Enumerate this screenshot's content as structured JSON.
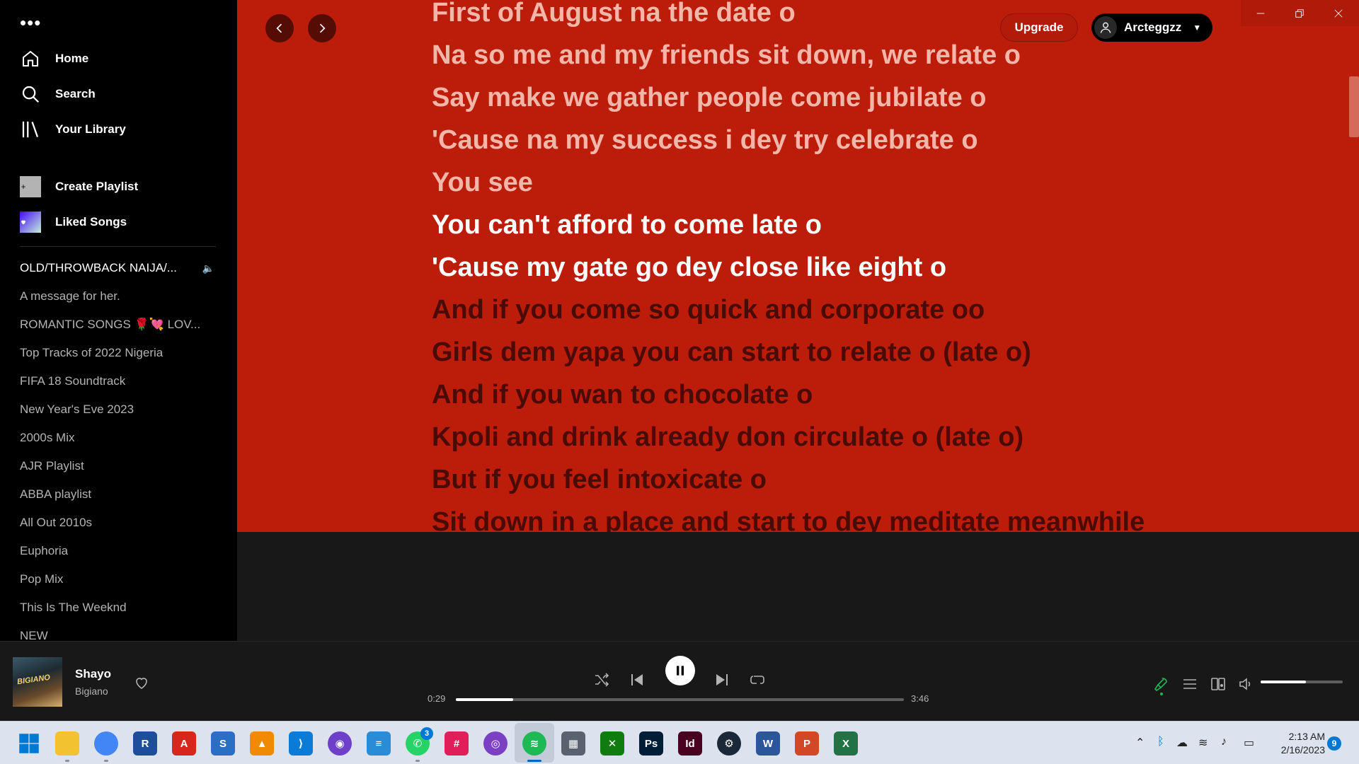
{
  "sidebar": {
    "menu_dots": "•••",
    "nav": [
      {
        "label": "Home",
        "icon": "home-icon"
      },
      {
        "label": "Search",
        "icon": "search-icon"
      },
      {
        "label": "Your Library",
        "icon": "library-icon"
      }
    ],
    "create_playlist": "Create Playlist",
    "liked_songs": "Liked Songs",
    "playlists": [
      "OLD/THROWBACK NAIJA/...",
      "A message for her.",
      "ROMANTIC SONGS 🌹💘 LOV...",
      "Top Tracks of 2022 Nigeria",
      "FIFA 18 Soundtrack",
      "New Year's Eve 2023",
      "2000s Mix",
      "AJR Playlist",
      "ABBA playlist",
      "All Out 2010s",
      "Euphoria",
      "Pop Mix",
      "This Is The Weeknd",
      "NEW"
    ]
  },
  "header": {
    "upgrade": "Upgrade",
    "username": "Arcteggzz"
  },
  "lyrics": [
    {
      "text": "First of August na the date o",
      "state": "past"
    },
    {
      "text": "Na so me and my friends sit down, we relate o",
      "state": "past"
    },
    {
      "text": "Say make we gather people come jubilate o",
      "state": "past"
    },
    {
      "text": "'Cause na my success i dey try celebrate o",
      "state": "past"
    },
    {
      "text": "You see",
      "state": "past"
    },
    {
      "text": "You can't afford to come late o",
      "state": "current"
    },
    {
      "text": "'Cause my gate go dey close like eight o",
      "state": "current"
    },
    {
      "text": "And if you come so quick and corporate oo",
      "state": "future"
    },
    {
      "text": "Girls dem yapa you can start to relate o (late o)",
      "state": "future"
    },
    {
      "text": "And if you wan to chocolate o",
      "state": "future"
    },
    {
      "text": "Kpoli and drink already don circulate o (late o)",
      "state": "future"
    },
    {
      "text": "But if you feel intoxicate o",
      "state": "future"
    },
    {
      "text": "Sit down in a place and start to dey meditate meanwhile",
      "state": "future"
    }
  ],
  "colors": {
    "lyrics_bg": "#bc1c0a",
    "accent_green": "#1db954"
  },
  "player": {
    "title": "Shayo",
    "artist": "Bigiano",
    "cover_text": "BIGIANO",
    "elapsed": "0:29",
    "duration": "3:46",
    "progress_fraction": 0.128,
    "volume_fraction": 0.55
  },
  "taskbar": {
    "apps": [
      {
        "name": "file-explorer-icon",
        "glyph": "",
        "color": "#f2c230"
      },
      {
        "name": "chrome-icon",
        "glyph": "",
        "color": "#4285f4"
      },
      {
        "name": "r-app-icon",
        "glyph": "R",
        "color": "#1e4d9b"
      },
      {
        "name": "acrobat-icon",
        "glyph": "A",
        "color": "#d7261b"
      },
      {
        "name": "sketchup-icon",
        "glyph": "S",
        "color": "#2a6fc4"
      },
      {
        "name": "vlc-icon",
        "glyph": "▲",
        "color": "#f08a00"
      },
      {
        "name": "vscode-icon",
        "glyph": "⟩",
        "color": "#0a7bd6"
      },
      {
        "name": "github-icon",
        "glyph": "◉",
        "color": "#6e40c9"
      },
      {
        "name": "notepad-icon",
        "glyph": "≡",
        "color": "#2a8bd6"
      },
      {
        "name": "whatsapp-icon",
        "glyph": "✆",
        "color": "#25d366"
      },
      {
        "name": "slack-icon",
        "glyph": "#",
        "color": "#e01e5a"
      },
      {
        "name": "podcast-icon",
        "glyph": "◎",
        "color": "#7b3fc4"
      },
      {
        "name": "spotify-icon",
        "glyph": "≋",
        "color": "#1db954"
      },
      {
        "name": "calculator-icon",
        "glyph": "▦",
        "color": "#5a6270"
      },
      {
        "name": "xbox-icon",
        "glyph": "✕",
        "color": "#107c10"
      },
      {
        "name": "photoshop-icon",
        "glyph": "Ps",
        "color": "#001e36"
      },
      {
        "name": "indesign-icon",
        "glyph": "Id",
        "color": "#49021f"
      },
      {
        "name": "steam-icon",
        "glyph": "⚙",
        "color": "#1b2838"
      },
      {
        "name": "word-icon",
        "glyph": "W",
        "color": "#2b579a"
      },
      {
        "name": "powerpoint-icon",
        "glyph": "P",
        "color": "#d24726"
      },
      {
        "name": "excel-icon",
        "glyph": "X",
        "color": "#217346"
      }
    ],
    "whatsapp_badge": "3",
    "clock_time": "2:13 AM",
    "clock_date": "2/16/2023",
    "notification_count": "9"
  }
}
